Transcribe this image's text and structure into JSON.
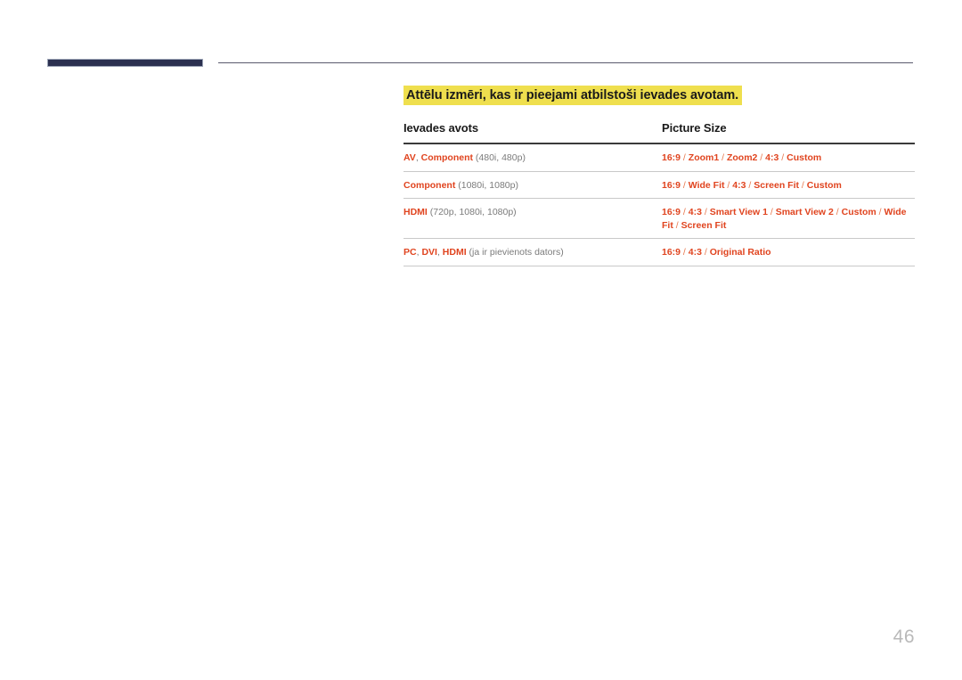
{
  "page": {
    "number": "46"
  },
  "heading": {
    "text": "Attēlu izmēri, kas ir pieejami atbilstoši ievades avotam.",
    "highlight_color": "#efdf4e"
  },
  "table": {
    "columns": [
      {
        "label": "Ievades avots"
      },
      {
        "label": "Picture Size"
      }
    ],
    "rows": [
      {
        "source_terms": [
          "AV",
          "Component"
        ],
        "source_text": "AV, Component",
        "source_note": "(480i, 480p)",
        "picture_size": "16:9 / Zoom1 / Zoom2 / 4:3 / Custom",
        "picture_size_terms": [
          "16:9",
          "Zoom1",
          "Zoom2",
          "4:3",
          "Custom"
        ]
      },
      {
        "source_terms": [
          "Component"
        ],
        "source_text": "Component",
        "source_note": "(1080i, 1080p)",
        "picture_size": "16:9 / Wide Fit / 4:3 / Screen Fit / Custom",
        "picture_size_terms": [
          "16:9",
          "Wide Fit",
          "4:3",
          "Screen Fit",
          "Custom"
        ]
      },
      {
        "source_terms": [
          "HDMI"
        ],
        "source_text": "HDMI",
        "source_note": "(720p, 1080i, 1080p)",
        "picture_size": "16:9 / 4:3 / Smart View 1 / Smart View 2 / Custom / Wide Fit / Screen Fit",
        "picture_size_terms": [
          "16:9",
          "4:3",
          "Smart View 1",
          "Smart View 2",
          "Custom",
          "Wide Fit",
          "Screen Fit"
        ]
      },
      {
        "source_terms": [
          "PC",
          "DVI",
          "HDMI"
        ],
        "source_text": "PC, DVI, HDMI",
        "source_note": "(ja ir pievienots dators)",
        "picture_size": "16:9 / 4:3 / Original Ratio",
        "picture_size_terms": [
          "16:9",
          "4:3",
          "Original Ratio"
        ]
      }
    ]
  },
  "colors": {
    "accent_red": "#e0441f",
    "navy": "#2b3050",
    "highlight": "#efdf4e",
    "note_gray": "#7b7b7b"
  }
}
